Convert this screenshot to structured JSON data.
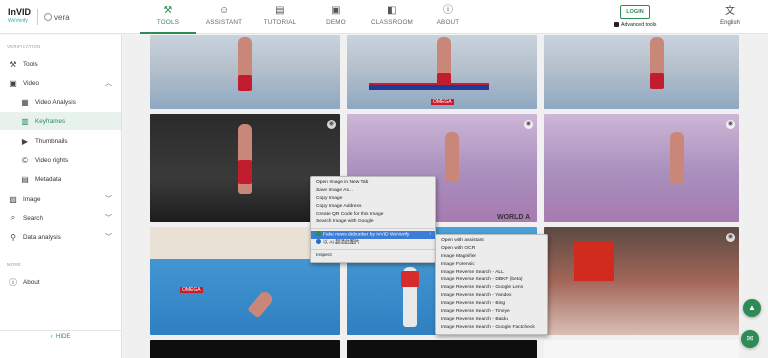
{
  "logo": {
    "invid": "InVID",
    "invid_sub": "WeVerify",
    "vera": "vera"
  },
  "nav": {
    "tabs": [
      {
        "label": "TOOLS",
        "icon": "wrench-icon",
        "glyph": "⚒"
      },
      {
        "label": "ASSISTANT",
        "icon": "assistant-icon",
        "glyph": "☺"
      },
      {
        "label": "TUTORIAL",
        "icon": "book-icon",
        "glyph": "▤"
      },
      {
        "label": "DEMO",
        "icon": "video-icon",
        "glyph": "▣"
      },
      {
        "label": "CLASSROOM",
        "icon": "classroom-icon",
        "glyph": "◧"
      },
      {
        "label": "ABOUT",
        "icon": "info-icon",
        "glyph": "ⓘ"
      }
    ],
    "login": "LOGIN",
    "advanced": "Advanced tools",
    "language": "English"
  },
  "sidebar": {
    "section_verification": "VERIFICATION",
    "section_more": "MORE",
    "items": [
      {
        "label": "Tools",
        "icon": "wrench-icon"
      },
      {
        "label": "Video",
        "icon": "video-icon"
      },
      {
        "label": "Video Analysis",
        "icon": "video-analysis-icon"
      },
      {
        "label": "Keyframes",
        "icon": "keyframes-icon"
      },
      {
        "label": "Thumbnails",
        "icon": "thumbnails-icon"
      },
      {
        "label": "Video rights",
        "icon": "copyright-icon"
      },
      {
        "label": "Metadata",
        "icon": "metadata-icon"
      },
      {
        "label": "Image",
        "icon": "image-icon"
      },
      {
        "label": "Search",
        "icon": "search-icon"
      },
      {
        "label": "Data analysis",
        "icon": "data-analysis-icon"
      },
      {
        "label": "About",
        "icon": "info-icon"
      }
    ],
    "hide": "HIDE"
  },
  "thumbs": {
    "omega": "OMEGA",
    "worlda": "WORLD A"
  },
  "menu1": {
    "items": [
      "Open Image in New Tab",
      "Save Image As...",
      "Copy Image",
      "Copy Image Address",
      "Create QR Code for this Image",
      "Search Image with Google",
      "Fake news debunker by InVID  WeVerify",
      "以 AI 超清此图片",
      "Inspect"
    ]
  },
  "menu2": {
    "items": [
      "Open with assistant",
      "Open with OCR",
      "Image Magnifier",
      "Image Forensic",
      "Image Reverse Search - ALL",
      "Image Reverse Search - DBKF (beta)",
      "Image Reverse Search - Google Lens",
      "Image Reverse Search - Yandex",
      "Image Reverse Search - Bing",
      "Image Reverse Search - Tineye",
      "Image Reverse Search - Baidu",
      "Image Reverse Search - Google Factcheck"
    ]
  },
  "colors": {
    "accent": "#2e8b57",
    "menu_highlight": "#3d7dd8"
  }
}
